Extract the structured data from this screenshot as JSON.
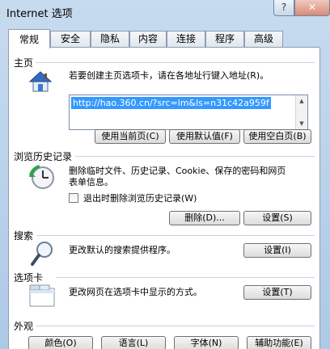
{
  "window": {
    "title": "Internet 选项",
    "help_label": "?",
    "close_label": "✕"
  },
  "tabs": [
    "常规",
    "安全",
    "隐私",
    "内容",
    "连接",
    "程序",
    "高级"
  ],
  "homepage": {
    "section_label": "主页",
    "description": "若要创建主页选项卡，请在各地址行键入地址(R)。",
    "url": "http://hao.360.cn/?src=lm&ls=n31c42a959f",
    "buttons": [
      "使用当前页(C)",
      "使用默认值(F)",
      "使用空白页(B)"
    ]
  },
  "history": {
    "section_label": "浏览历史记录",
    "description_line1": "删除临时文件、历史记录、Cookie、保存的密码和网页",
    "description_line2": "表单信息。",
    "checkbox_label": "退出时删除浏览历史记录(W)",
    "delete_button": "删除(D)...",
    "settings_button": "设置(S)"
  },
  "search": {
    "section_label": "搜索",
    "description": "更改默认的搜索提供程序。",
    "settings_button": "设置(I)"
  },
  "tabs_section": {
    "section_label": "选项卡",
    "description": "更改网页在选项卡中显示的方式。",
    "settings_button": "设置(T)"
  },
  "appearance": {
    "section_label": "外观",
    "buttons": [
      "颜色(O)",
      "语言(L)",
      "字体(N)",
      "辅助功能(E)"
    ]
  },
  "colors": {
    "selection": "#3399ff",
    "title_bg": "#c7dbef"
  }
}
